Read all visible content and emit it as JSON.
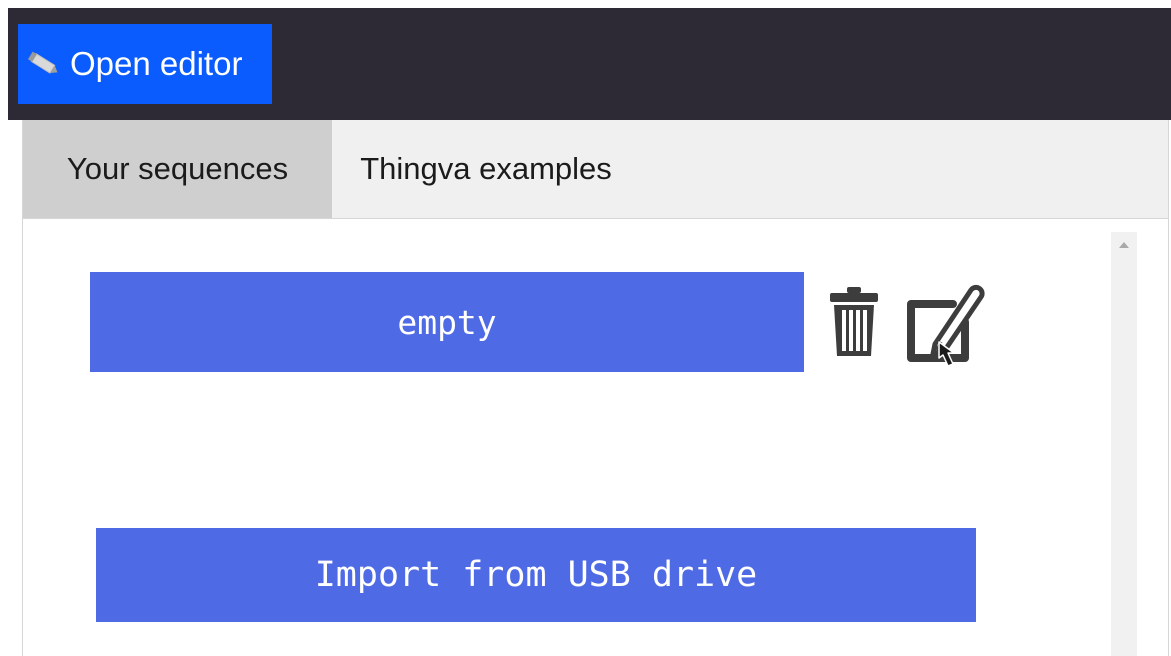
{
  "header": {
    "open_editor_label": "Open editor",
    "open_editor_icon": "pencil-icon",
    "background_color": "#2d2a36",
    "button_color": "#0a5cff"
  },
  "tabs": [
    {
      "label": "Your sequences",
      "active": true
    },
    {
      "label": "Thingva examples",
      "active": false
    }
  ],
  "sequences": [
    {
      "label": "empty",
      "actions": [
        "trash-icon",
        "edit-icon"
      ]
    }
  ],
  "import_button": {
    "label": "Import from USB drive"
  },
  "colors": {
    "accent": "#4f6ae5",
    "active_tab": "#cfcfcf",
    "inactive_tab": "#f0f0f0"
  }
}
